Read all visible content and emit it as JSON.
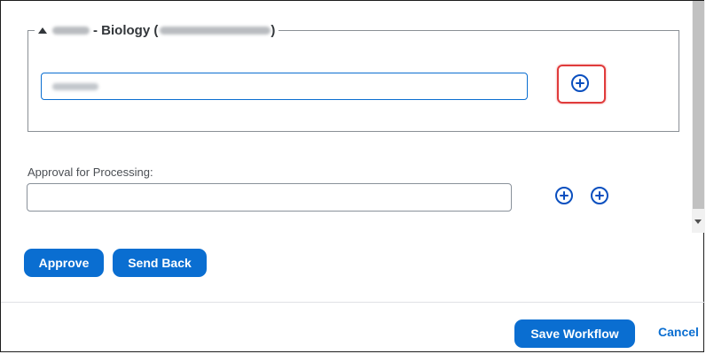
{
  "section": {
    "title_text": "- Biology (",
    "title_close": ")"
  },
  "approval": {
    "label": "Approval for Processing:"
  },
  "actions": {
    "approve_label": "Approve",
    "send_back_label": "Send Back"
  },
  "footer": {
    "save_label": "Save Workflow",
    "cancel_label": "Cancel"
  },
  "colors": {
    "accent": "#0a6ed1",
    "icon_blue": "#0a4fbf",
    "highlight": "#e03b3b"
  },
  "icons": {
    "add": "circle-plus-icon",
    "collapse": "triangle-up-icon",
    "scroll_down": "arrow-down-icon"
  }
}
